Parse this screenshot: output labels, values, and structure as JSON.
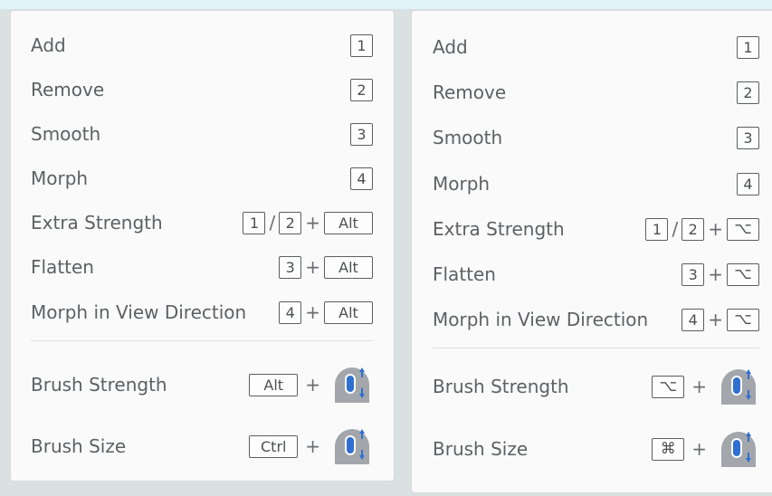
{
  "left_panel": {
    "rows": [
      {
        "label": "Add",
        "key": "1"
      },
      {
        "label": "Remove",
        "key": "2"
      },
      {
        "label": "Smooth",
        "key": "3"
      },
      {
        "label": "Morph",
        "key": "4"
      },
      {
        "label": "Extra Strength",
        "key_a": "1",
        "slash": "/",
        "key_b": "2",
        "plus": "+",
        "modifier": "Alt"
      },
      {
        "label": "Flatten",
        "key": "3",
        "plus": "+",
        "modifier": "Alt"
      },
      {
        "label": "Morph in View Direction",
        "key": "4",
        "plus": "+",
        "modifier": "Alt"
      }
    ],
    "brush_strength": {
      "label": "Brush Strength",
      "modifier": "Alt",
      "plus": "+",
      "icon": "mouse-scroll-icon"
    },
    "brush_size": {
      "label": "Brush Size",
      "modifier": "Ctrl",
      "plus": "+",
      "icon": "mouse-scroll-icon"
    }
  },
  "right_panel": {
    "rows": [
      {
        "label": "Add",
        "key": "1"
      },
      {
        "label": "Remove",
        "key": "2"
      },
      {
        "label": "Smooth",
        "key": "3"
      },
      {
        "label": "Morph",
        "key": "4"
      },
      {
        "label": "Extra Strength",
        "key_a": "1",
        "slash": "/",
        "key_b": "2",
        "plus": "+",
        "modifier": "⌥"
      },
      {
        "label": "Flatten",
        "key": "3",
        "plus": "+",
        "modifier": "⌥"
      },
      {
        "label": "Morph in View Direction",
        "key": "4",
        "plus": "+",
        "modifier": "⌥"
      }
    ],
    "brush_strength": {
      "label": "Brush Strength",
      "modifier": "⌥",
      "plus": "+",
      "icon": "mouse-scroll-icon"
    },
    "brush_size": {
      "label": "Brush Size",
      "modifier": "⌘",
      "plus": "+",
      "icon": "mouse-scroll-icon"
    }
  },
  "colors": {
    "panel_bg": "#fafafa",
    "text": "#5e6062",
    "key_border": "#5c5e60",
    "mouse_accent": "#2f6fd0",
    "mouse_body": "#9ea2a6"
  }
}
